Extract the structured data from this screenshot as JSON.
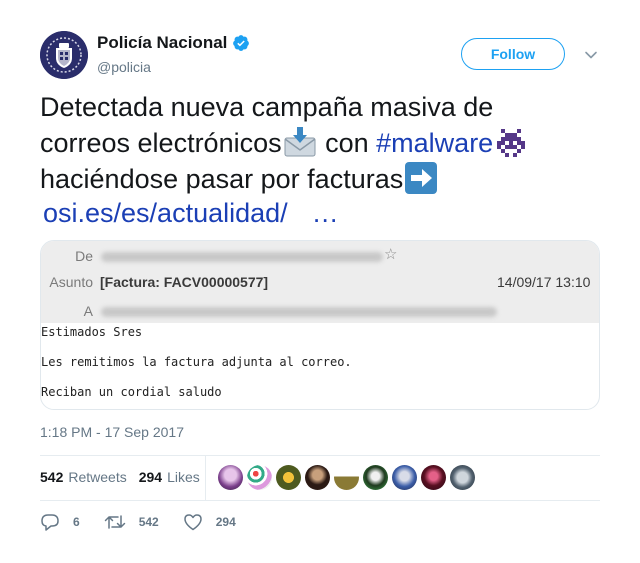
{
  "account": {
    "name": "Policía Nacional",
    "handle": "@policia",
    "verified": true,
    "avatar_icon": "police-badge-icon",
    "avatar_color": "#2a2d6b"
  },
  "follow_label": "Follow",
  "tweet": {
    "line1": "Detectada nueva campaña masiva de",
    "line2_a": "correos electrónicos",
    "line2_b": " con ",
    "hashtag": "#malware",
    "line3": "haciéndose pasar por facturas",
    "link": "osi.es/es/actualidad/",
    "ellipsis": "…",
    "emojis": [
      "incoming-envelope-icon",
      "space-invader-icon",
      "right-arrow-icon"
    ]
  },
  "email_preview": {
    "from_label": "De",
    "subject_label": "Asunto",
    "subject": "[Factura: FACV00000577]",
    "date": "14/09/17 13:10",
    "to_label": "A",
    "body_lines": [
      "Estimados Sres",
      "Les remitimos la factura adjunta al correo.",
      "Reciban un cordial saludo"
    ]
  },
  "timestamp": "1:18 PM - 17 Sep 2017",
  "stats": {
    "retweets_count": "542",
    "retweets_label": "Retweets",
    "likes_count": "294",
    "likes_label": "Likes"
  },
  "actions": {
    "replies": "6",
    "retweets": "542",
    "likes": "294"
  },
  "colors": {
    "accent": "#1da1f2",
    "link": "#1b3fb5",
    "muted": "#657786"
  }
}
